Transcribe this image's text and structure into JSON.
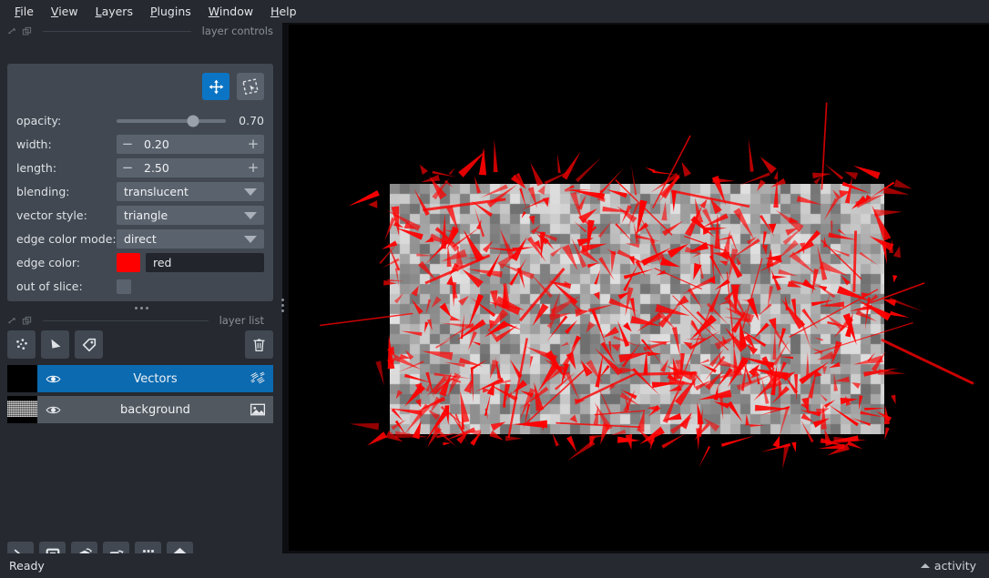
{
  "menu": {
    "items": [
      {
        "label": "File",
        "accel": "F"
      },
      {
        "label": "View",
        "accel": "V"
      },
      {
        "label": "Layers",
        "accel": "L"
      },
      {
        "label": "Plugins",
        "accel": "P"
      },
      {
        "label": "Window",
        "accel": "W"
      },
      {
        "label": "Help",
        "accel": "H"
      }
    ]
  },
  "docks": {
    "layer_controls_title": "layer controls",
    "layer_list_title": "layer list"
  },
  "layer_controls": {
    "tools": [
      {
        "name": "pan-zoom",
        "active": true
      },
      {
        "name": "transform-select",
        "active": false
      }
    ],
    "opacity": {
      "label": "opacity:",
      "value": "0.70",
      "percent": 70
    },
    "width": {
      "label": "width:",
      "value": "0.20",
      "minus": "−",
      "plus": "+"
    },
    "length": {
      "label": "length:",
      "value": "2.50",
      "minus": "−",
      "plus": "+"
    },
    "blending": {
      "label": "blending:",
      "value": "translucent"
    },
    "vector_style": {
      "label": "vector style:",
      "value": "triangle"
    },
    "edge_color_mode": {
      "label": "edge color mode:",
      "value": "direct"
    },
    "edge_color": {
      "label": "edge color:",
      "value": "red",
      "swatch": "#ff0000"
    },
    "out_of_slice": {
      "label": "out of slice:",
      "checked": false
    }
  },
  "layer_buttons": [
    {
      "name": "new-points-layer"
    },
    {
      "name": "new-shapes-layer"
    },
    {
      "name": "new-labels-layer"
    },
    {
      "name": "delete-layer"
    }
  ],
  "layers": [
    {
      "name": "Vectors",
      "type": "vectors",
      "visible": true,
      "selected": true
    },
    {
      "name": "background",
      "type": "image",
      "visible": true,
      "selected": false
    }
  ],
  "viewer_buttons": [
    {
      "name": "console"
    },
    {
      "name": "ndisplay-toggle"
    },
    {
      "name": "roll-dims"
    },
    {
      "name": "transpose-dims"
    },
    {
      "name": "grid-view"
    },
    {
      "name": "home"
    }
  ],
  "statusbar": {
    "status": "Ready",
    "activity_label": "activity"
  },
  "colors": {
    "accent": "#0b74c4",
    "panel": "#262930",
    "card": "#414851",
    "canvas": "#000000",
    "vector": "#ff0000"
  }
}
